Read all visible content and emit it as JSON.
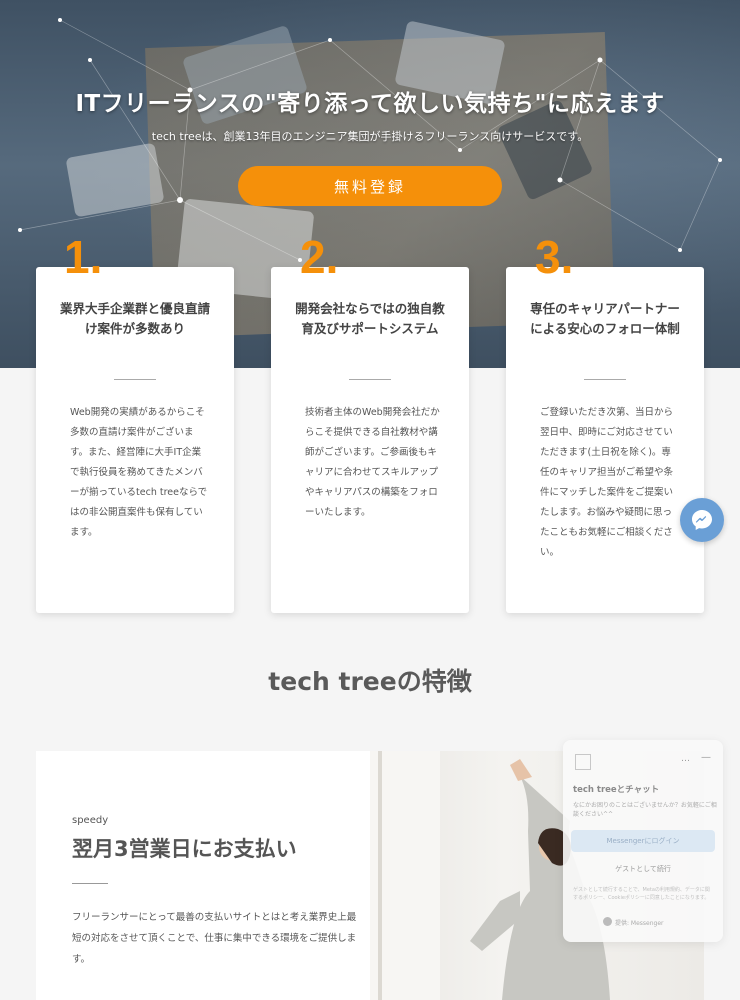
{
  "hero": {
    "title": "ITフリーランスの\"寄り添って欲しい気持ち\"に応えます",
    "subtitle": "tech treeは、創業13年目のエンジニア集団が手掛けるフリーランス向けサービスです。",
    "register_label": "無料登録"
  },
  "features": [
    {
      "number": "1.",
      "title": "業界大手企業群と優良直請け案件が多数あり",
      "text": "Web開発の実績があるからこそ多数の直請け案件がございます。また、経営陣に大手IT企業で執行役員を務めてきたメンバーが揃っているtech treeならではの非公開直案件も保有しています。"
    },
    {
      "number": "2.",
      "title": "開発会社ならではの独自教育及びサポートシステム",
      "text": "技術者主体のWeb開発会社だからこそ提供できる自社教材や講師がございます。ご参画後もキャリアに合わせてスキルアップやキャリアパスの構築をフォローいたします。"
    },
    {
      "number": "3.",
      "title": "専任のキャリアパートナーによる安心のフォロー体制",
      "text": "ご登録いただき次第、当日から翌日中、即時にご対応させていただきます(土日祝を除く)。専任のキャリア担当がご希望や条件にマッチした案件をご提案いたします。お悩みや疑問に思ったこともお気軽にご相談ください。"
    }
  ],
  "section": {
    "title": "tech treeの特徴"
  },
  "speedy": {
    "label": "speedy",
    "heading": "翌月3営業日にお支払い",
    "text": "フリーランサーにとって最善の支払いサイトとはと考え業界史上最短の対応をさせて頂くことで、仕事に集中できる環境をご提供します。"
  },
  "chat": {
    "title": "tech treeとチャット",
    "description": "なにかお困りのことはございませんか？お気軽にご相談ください^^",
    "login_label": "Messengerにログイン",
    "guest_label": "ゲストとして続行",
    "policy": "ゲストとして続行することで、Metaの利用規約、データに関するポリシー、Cookieポリシーに同意したことになります。",
    "footer": "提供: Messenger",
    "dots": "…",
    "minimize": "—"
  },
  "colors": {
    "accent": "#f5900a",
    "messenger": "#6a9fd6"
  }
}
